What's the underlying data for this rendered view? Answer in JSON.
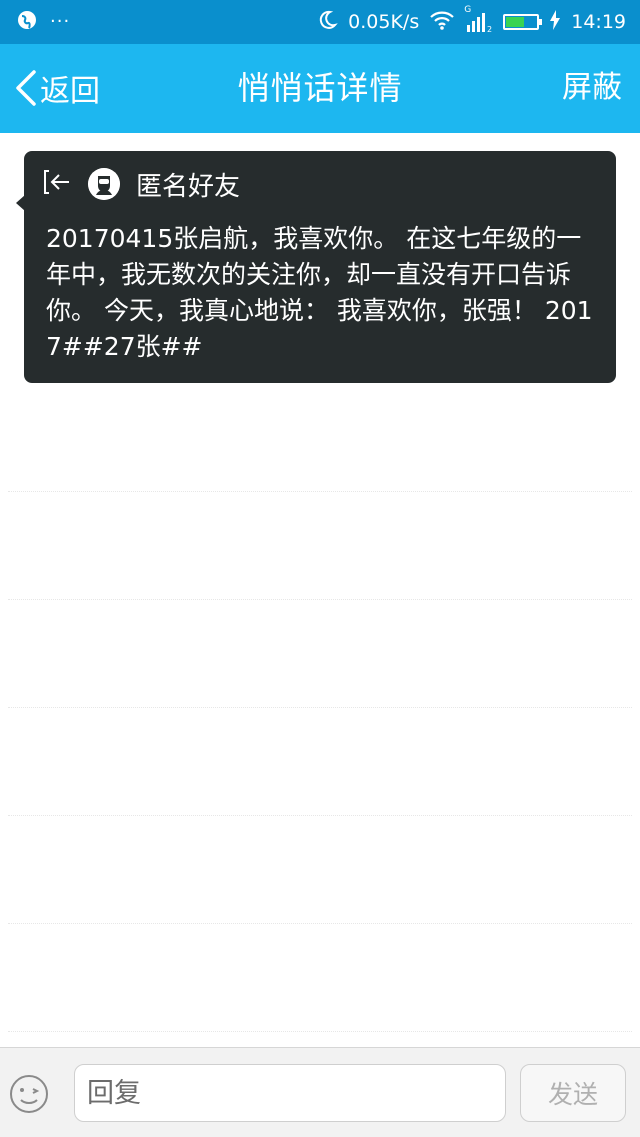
{
  "status_bar": {
    "dots": "···",
    "net_speed": "0.05K/s",
    "time": "14:19",
    "signal_label": "G",
    "battery_level": 0.6,
    "icons": [
      "globe-icon",
      "moon-icon",
      "wifi-icon",
      "signal-icon",
      "battery-icon",
      "charging-icon"
    ]
  },
  "header": {
    "back_label": "返回",
    "title": "悄悄话详情",
    "block_label": "屏蔽"
  },
  "message": {
    "sender": "匿名好友",
    "text": "20170415张启航，我喜欢你。 在这七年级的一年中，我无数次的关注你，却一直没有开口告诉你。 今天，我真心地说： 我喜欢你，张强！ 2017##27张##"
  },
  "reply_bar": {
    "placeholder": "回复",
    "send_label": "发送"
  },
  "colors": {
    "status_bar": "#0a8fcd",
    "title_bar": "#1db7f0",
    "card": "#262c2d"
  }
}
